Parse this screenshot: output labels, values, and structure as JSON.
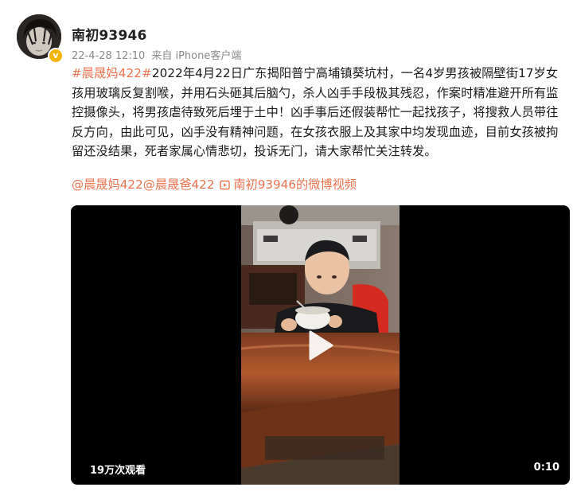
{
  "user": {
    "name": "南初93946",
    "avatar_icon": "user-avatar",
    "verified_icon": "verified-badge-icon",
    "verified_color": "#f5b400"
  },
  "meta": {
    "date": "22-4-28 12:10",
    "source": "来自 iPhone客户端"
  },
  "post": {
    "hashtag": "#晨晟妈422#",
    "text": "2022年4月22日广东揭阳普宁高埔镇葵坑村，一名4岁男孩被隔壁街17岁女孩用玻璃反复割喉，并用石头砸其后脑勺，杀人凶手手段极其残忍，作案时精准避开所有监控摄像头，将男孩虐待致死后埋于土中！凶手事后还假装帮忙一起找孩子，将搜救人员带往反方向，由此可见，凶手没有精神问题，在女孩衣服上及其家中均发现血迹，目前女孩被拘留还没结果，死者家属心情悲切，投诉无门，请大家帮忙关注转发。",
    "mention_1": "@晨晟妈422",
    "mention_2": "@晨晟爸422",
    "video_link": "南初93946的微博视频",
    "link_color": "#eb7350"
  },
  "video": {
    "views": "19万次观看",
    "duration": "0:10",
    "play_icon": "play-icon"
  }
}
